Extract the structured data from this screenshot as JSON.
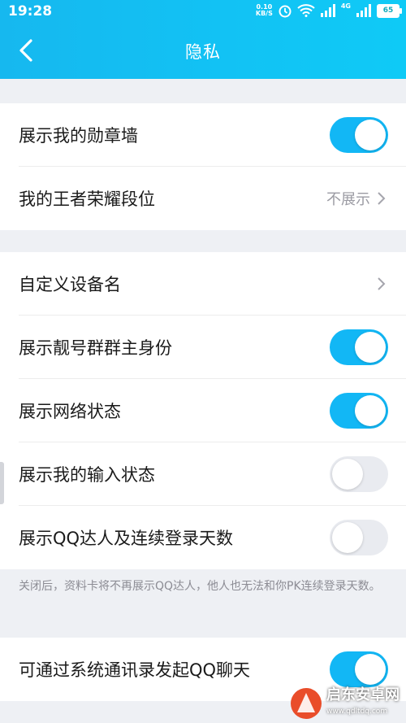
{
  "status": {
    "time": "19:28",
    "speed_value": "0.10",
    "speed_unit": "KB/S",
    "network": "4G",
    "battery": "65"
  },
  "header": {
    "title": "隐私"
  },
  "group1": [
    {
      "label": "展示我的勋章墙",
      "toggle": "on"
    },
    {
      "label": "我的王者荣耀段位",
      "value": "不展示"
    }
  ],
  "group2": [
    {
      "label": "自定义设备名"
    },
    {
      "label": "展示靓号群群主身份",
      "toggle": "on"
    },
    {
      "label": "展示网络状态",
      "toggle": "on"
    },
    {
      "label": "展示我的输入状态",
      "toggle": "off"
    },
    {
      "label": "展示QQ达人及连续登录天数",
      "toggle": "off"
    }
  ],
  "note": "关闭后，资料卡将不再展示QQ达人，他人也无法和你PK连续登录天数。",
  "group3": [
    {
      "label": "可通过系统通讯录发起QQ聊天",
      "toggle": "on"
    }
  ],
  "watermark": {
    "name": "启东安卓网",
    "url": "www.qdltdq.com"
  },
  "colors": {
    "accent": "#12b7f5",
    "background": "#eef0f4",
    "toggle_off": "#e9ebf0"
  }
}
